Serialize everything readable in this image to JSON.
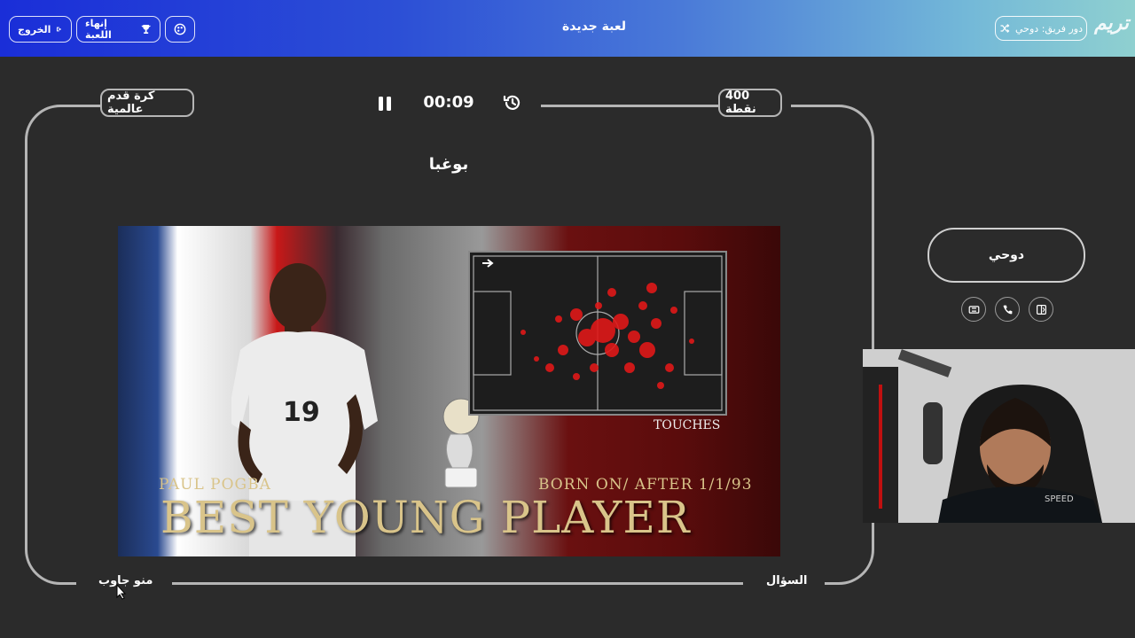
{
  "header": {
    "exit_label": "الخروج",
    "end_game_label": "إنهاء اللعبة",
    "title": "لعبة جديدة",
    "team_turn_label": "دور فريق: دوحي",
    "logo_text": "تريم"
  },
  "game": {
    "category": "كرة قدم عالمية",
    "points": "400 نقطة",
    "timer": "00:09",
    "answer": "بوغبا",
    "question_label": "السؤال",
    "who_answered_label": "منو جاوب"
  },
  "image": {
    "pitch_label": "TOUCHES",
    "player_name": "PAUL POGBA",
    "born_text": "BORN ON/ AFTER 1/1/93",
    "headline": "BEST YOUNG PLAYER",
    "jersey_number": "19"
  },
  "side_panel": {
    "team_name": "دوحي"
  },
  "colors": {
    "header_start": "#1a2ed8",
    "header_end": "#8fd0d0",
    "background": "#2b2b2b",
    "frame_border": "#b5b5b5",
    "heatmap_red": "#e01818",
    "gold_text": "#d9c48a"
  },
  "icons": {
    "exit": "exit-icon",
    "trophy": "trophy-icon",
    "palette": "palette-icon",
    "shuffle": "shuffle-icon",
    "pause": "pause-icon",
    "history": "history-icon",
    "phone": "phone-icon",
    "swap": "swap-icon",
    "double_points": "double-icon"
  }
}
